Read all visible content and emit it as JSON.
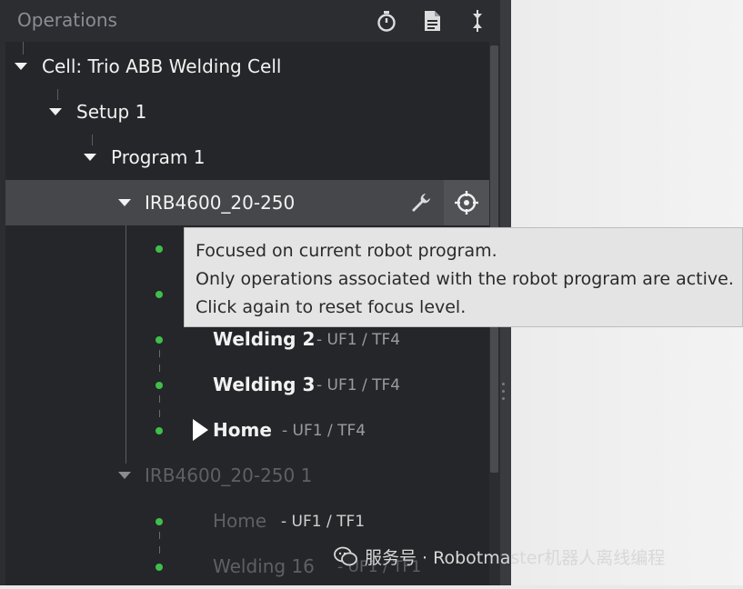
{
  "header": {
    "title": "Operations",
    "icons": [
      "stopwatch-icon",
      "document-icon",
      "collapse-icon"
    ]
  },
  "tree": {
    "cell": "Cell: Trio ABB Welding Cell",
    "setup": "Setup 1",
    "program": "Program 1",
    "robot1": {
      "name": "IRB4600_20-250",
      "operations": [
        {
          "name": "Welding 2",
          "frames": "- UF1 / TF4"
        },
        {
          "name": "Welding 3",
          "frames": "- UF1 / TF4"
        },
        {
          "name": "Home",
          "frames": "- UF1 / TF4"
        }
      ]
    },
    "robot2": {
      "name": "IRB4600_20-250 1",
      "operations": [
        {
          "name": "Home",
          "frames": "- UF1 / TF1"
        },
        {
          "name": "Welding 16",
          "frames": "- UF1 / TF1"
        }
      ]
    }
  },
  "tooltip": {
    "line1": "Focused on current robot program.",
    "line2": "Only operations associated with the robot program are active.",
    "line3": "Click again to reset focus level."
  },
  "watermark": {
    "text": "服务号 · Robotmaster机器人离线编程"
  },
  "colors": {
    "panel": "#2c2d31",
    "tree_bg": "#252629",
    "selected_row": "#45474b",
    "active_dot": "#3fbf4a",
    "tooltip_bg": "#e4e4e4"
  }
}
